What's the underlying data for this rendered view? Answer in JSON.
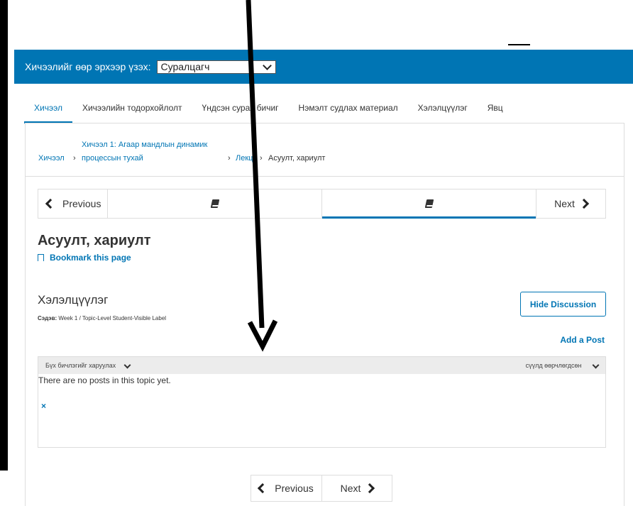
{
  "masquerade": {
    "label": "Хичээлийг өөр эрхээр үзэх:",
    "selected": "Суралцагч"
  },
  "tabs": [
    {
      "label": "Хичээл",
      "active": true
    },
    {
      "label": "Хичээлийн тодорхойлолт"
    },
    {
      "label": "Үндсэн сурах бичиг"
    },
    {
      "label": "Нэмэлт судлах материал"
    },
    {
      "label": "Хэлэлцүүлэг"
    },
    {
      "label": "Явц"
    }
  ],
  "breadcrumb": {
    "root": "Хичээл",
    "section_line1": "Хичээл 1: Агаар мандлын динамик",
    "section_line2": "процессын тухай",
    "subsection": "Лекц",
    "current": "Асуулт, хариулт"
  },
  "sequence": {
    "prev_label": "Previous",
    "next_label": "Next",
    "units": [
      {
        "icon": "book-icon"
      },
      {
        "icon": "book-icon",
        "active": true
      }
    ]
  },
  "page": {
    "title": "Асуулт, хариулт",
    "bookmark_label": "Bookmark this page"
  },
  "discussion": {
    "title": "Хэлэлцүүлэг",
    "topic_label": "Сэдэв:",
    "topic_value": " Week 1 / Topic-Level Student-Visible Label",
    "hide_button": "Hide Discussion",
    "add_post": "Add a Post",
    "filter_label": "Бүх бичлэгийг харуулах",
    "sort_label": "сүүлд өөрчлөгдсөн",
    "empty_message": "There are no posts in this topic yet.",
    "close_icon": "×"
  },
  "bottom_nav": {
    "prev_label": "Previous",
    "next_label": "Next"
  },
  "colors": {
    "brand": "#0075b4",
    "annotation_arrow": "#000000"
  }
}
